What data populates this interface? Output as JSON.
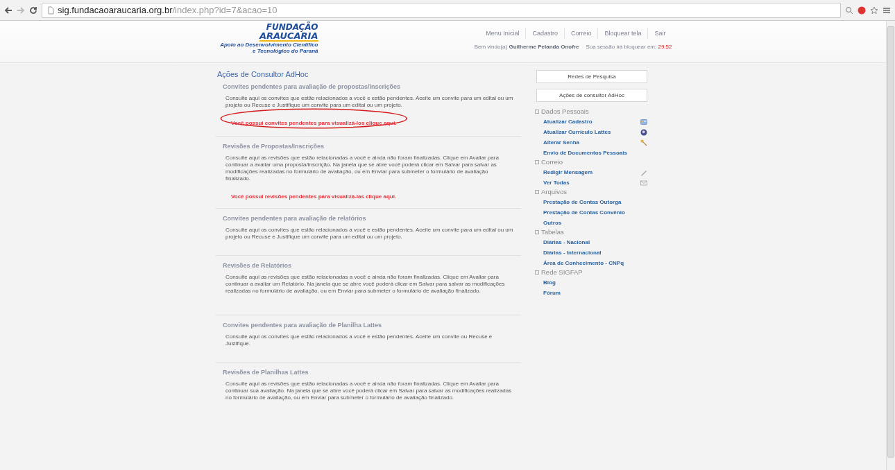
{
  "browser": {
    "url_host": "sig.fundacaoaraucaria.org.br",
    "url_path": "/index.php?id=7&acao=10"
  },
  "header": {
    "logo": {
      "line1": "FUNDAÇÃO",
      "line2": "ARAUCARIA",
      "tagline1": "Apoio ao Desenvolvimento Científico",
      "tagline2": "e Tecnológico do Paraná"
    },
    "nav": [
      "Menu Inicial",
      "Cadastro",
      "Correio",
      "Bloquear tela",
      "Sair"
    ],
    "welcome": "Bem vindo(a)",
    "user": "Guilherme Pelanda Onofre",
    "session_label": "Sua sessão irá bloquear em:",
    "session_time": "29:52"
  },
  "main": {
    "title": "Ações de Consultor AdHoc",
    "sections": [
      {
        "heading": "Convites pendentes para avaliação de propostas/inscrições",
        "text": "Consulte aqui os convites que estão relacionados a você e estão pendentes. Aceite um convite para um edital ou um projeto ou Recuse e Justifique um convite para um edital ou um projeto.",
        "link": {
          "text": "Você possui convites pendentes para visualizá-los clique aqui.",
          "circled": true
        }
      },
      {
        "heading": "Revisões de Propostas/Inscrições",
        "text": "Consulte aqui as revisões que estão relacionadas a você e ainda não foram finalizadas. Clique em Avaliar para continuar a avaliar uma proposta/inscrição. Na janela que se abre você poderá clicar em Salvar para salvar as modificações realizadas no formulário de avaliação, ou em Enviar para submeter o formulário de avaliação finalizado.",
        "link": {
          "text": "Você possui revisões pendentes para visualizá-las clique aqui.",
          "circled": false
        }
      },
      {
        "heading": "Convites pendentes para avaliação de relatórios",
        "text": "Consulte aqui os convites que estão relacionados a você e estão pendentes. Aceite um convite para um edital ou um projeto ou Recuse e Justifique um convite para um edital ou um projeto."
      },
      {
        "heading": "Revisões de Relatórios",
        "text": "Consulte aqui as revisões que estão relacionadas a você e ainda não foram finalizadas. Clique em Avaliar para continuar a avaliar um Relatório. Na janela que se abre você poderá clicar em Salvar para salvar as modificações realizadas no formulário de avaliação, ou em Enviar para submeter o formulário de avaliação finalizado."
      },
      {
        "heading": "Convites pendentes para avaliação de Planilha Lattes",
        "text": "Consulte aqui os convites que estão relacionados a você e estão pendentes. Aceite um convite ou Recuse e Justifique."
      },
      {
        "heading": "Revisões de Planilhas Lattes",
        "text": "Consulte aqui as revisões que estão relacionadas a você e ainda não foram finalizadas. Clique em Avaliar para continuar sua avaliação. Na janela que se abre você poderá clicar em Salvar para salvar as modificações realizadas no formulário de avaliação, ou em Enviar para submeter o formulário de avaliação finalizado."
      }
    ]
  },
  "sidebar": {
    "buttons": [
      "Redes de Pesquisa",
      "Ações de consultor AdHoc"
    ],
    "groups": [
      {
        "title": "Dados Pessoais",
        "items": [
          {
            "label": "Atualizar Cadastro",
            "kind": "profile"
          },
          {
            "label": "Atualizar Currículo Lattes",
            "kind": "globe"
          },
          {
            "label": "Alterar Senha",
            "kind": "keys"
          },
          {
            "label": "Envio de Documentos Pessoais",
            "kind": "plain"
          }
        ]
      },
      {
        "title": "Correio",
        "items": [
          {
            "label": "Redigir Mensagem",
            "kind": "pen"
          },
          {
            "label": "Ver Todas",
            "kind": "mail"
          }
        ]
      },
      {
        "title": "Arquivos",
        "items": [
          {
            "label": "Prestação de Contas Outorga",
            "kind": "plain"
          },
          {
            "label": "Prestação de Contas Convênio",
            "kind": "plain"
          },
          {
            "label": "Outros",
            "kind": "plain"
          }
        ]
      },
      {
        "title": "Tabelas",
        "items": [
          {
            "label": "Diárias - Nacional",
            "kind": "plain"
          },
          {
            "label": "Diárias - Internacional",
            "kind": "plain"
          },
          {
            "label": "Área de Conhecimento - CNPq",
            "kind": "plain"
          }
        ]
      },
      {
        "title": "Rede SIGFAP",
        "items": [
          {
            "label": "Blog",
            "kind": "plain"
          },
          {
            "label": "Fórum",
            "kind": "plain"
          }
        ]
      }
    ]
  }
}
